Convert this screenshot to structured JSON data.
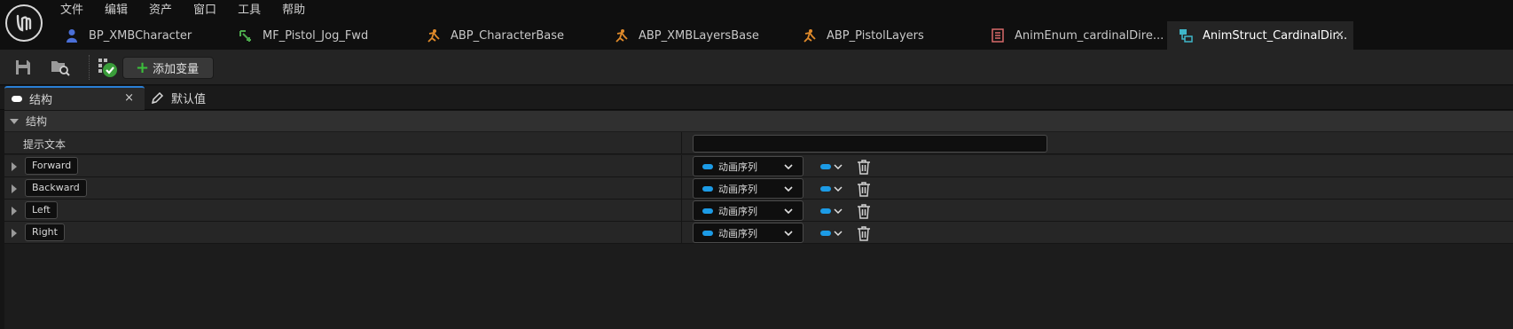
{
  "menu": [
    "文件",
    "编辑",
    "资产",
    "窗口",
    "工具",
    "帮助"
  ],
  "tabs": [
    {
      "label": "BP_XMBCharacter",
      "icon": "character-blueprint-icon",
      "icon_color": "#4a6fd8",
      "active": false
    },
    {
      "label": "MF_Pistol_Jog_Fwd",
      "icon": "animation-sequence-icon",
      "icon_color": "#4caa4c",
      "active": false
    },
    {
      "label": "ABP_CharacterBase",
      "icon": "animation-blueprint-icon",
      "icon_color": "#e08a2a",
      "active": false
    },
    {
      "label": "ABP_XMBLayersBase",
      "icon": "animation-blueprint-icon",
      "icon_color": "#e08a2a",
      "active": false
    },
    {
      "label": "ABP_PistolLayers",
      "icon": "animation-blueprint-icon",
      "icon_color": "#e08a2a",
      "active": false
    },
    {
      "label": "AnimEnum_cardinalDire...",
      "icon": "enum-icon",
      "icon_color": "#d86a6a",
      "active": false
    },
    {
      "label": "AnimStruct_CardinalDir...",
      "icon": "struct-icon",
      "icon_color": "#3fb6c9",
      "active": true
    }
  ],
  "toolbar": {
    "add_variable_label": "添加变量"
  },
  "panel_tabs": {
    "structure": "结构",
    "defaults": "默认值",
    "close": "×"
  },
  "section": {
    "title": "结构",
    "tooltip_label": "提示文本",
    "tooltip_value": ""
  },
  "variables": [
    {
      "name": "Forward",
      "type": "动画序列"
    },
    {
      "name": "Backward",
      "type": "动画序列"
    },
    {
      "name": "Left",
      "type": "动画序列"
    },
    {
      "name": "Right",
      "type": "动画序列"
    }
  ],
  "colors": {
    "accent": "#2a7fd6",
    "type_pill": "#1c9be6",
    "add_plus": "#3bbf3b"
  }
}
